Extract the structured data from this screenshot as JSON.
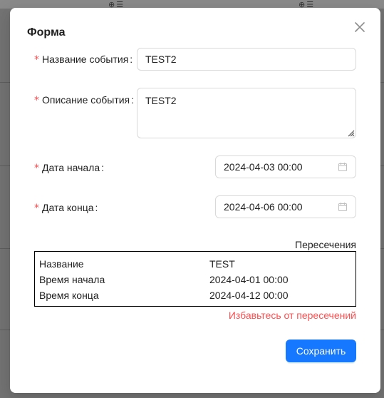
{
  "modal": {
    "title": "Форма",
    "close_icon": "close-icon",
    "required_mark": "*",
    "colon": ":"
  },
  "form": {
    "event_name": {
      "label": "Название события",
      "value": "TEST2"
    },
    "event_description": {
      "label": "Описание события",
      "value": "TEST2"
    },
    "start_date": {
      "label": "Дата начала",
      "value": "2024-04-03 00:00",
      "icon": "calendar-icon"
    },
    "end_date": {
      "label": "Дата конца",
      "value": "2024-04-06 00:00",
      "icon": "calendar-icon"
    }
  },
  "overlaps": {
    "title": "Пересечения",
    "rows": [
      {
        "key": "Название",
        "value": "TEST"
      },
      {
        "key": "Время начала",
        "value": "2024-04-01 00:00"
      },
      {
        "key": "Время конца",
        "value": "2024-04-12 00:00"
      }
    ],
    "error": "Избавьтесь от пересечений"
  },
  "actions": {
    "save_label": "Сохранить"
  },
  "colors": {
    "primary": "#1677ff",
    "error": "#ff4d4f",
    "overlay": "#737373"
  }
}
